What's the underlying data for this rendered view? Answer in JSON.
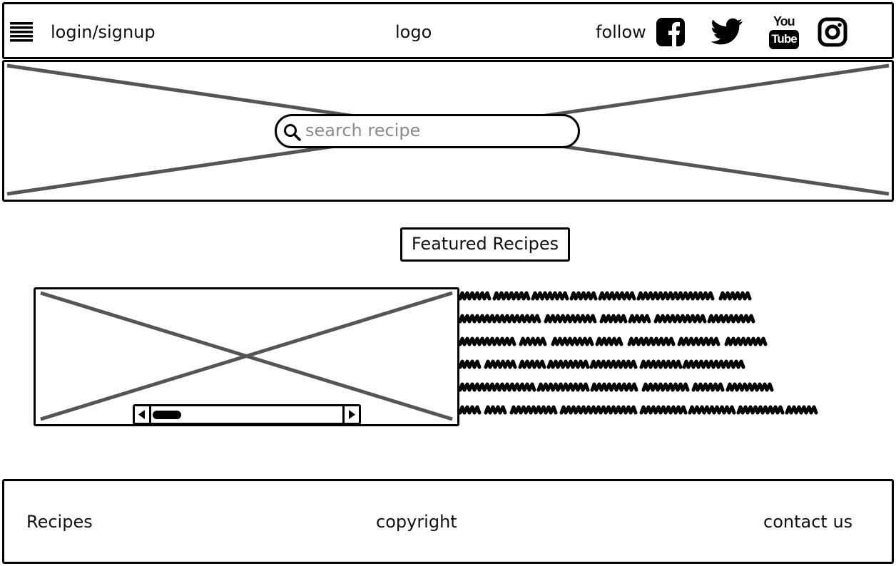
{
  "header": {
    "login_label": "login/signup",
    "logo_label": "logo",
    "follow_label": "follow",
    "icons": [
      "menu-icon",
      "facebook-icon",
      "twitter-icon",
      "youtube-icon",
      "instagram-icon"
    ],
    "youtube_you": "You",
    "youtube_tube": "Tube"
  },
  "hero": {
    "search_placeholder": "search recipe"
  },
  "featured": {
    "title": "Featured Recipes"
  },
  "footer": {
    "recipes_label": "Recipes",
    "copyright_label": "copyright",
    "contact_label": "contact us"
  },
  "colors": {
    "line": "#000000",
    "placeholder_x": "#555555",
    "placeholder_text": "#8a8a8a"
  }
}
